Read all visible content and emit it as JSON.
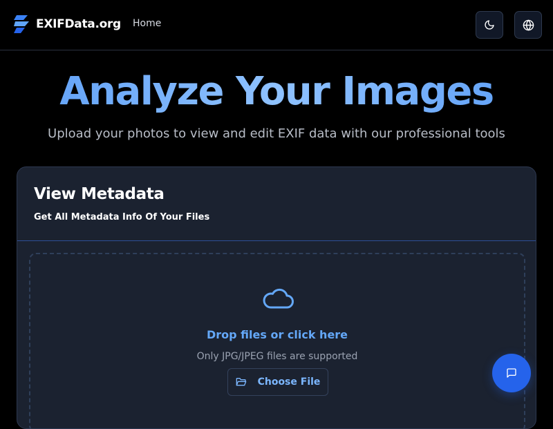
{
  "header": {
    "brand": "EXIFData.org",
    "nav": {
      "home": "Home"
    },
    "theme_toggle_icon": "moon-icon",
    "language_icon": "globe-icon"
  },
  "hero": {
    "title": "Analyze Your Images",
    "subtitle": "Upload your photos to view and edit EXIF data with our professional tools"
  },
  "card": {
    "title": "View Metadata",
    "subtitle": "Get All Metadata Info Of Your Files",
    "dropzone": {
      "icon": "cloud-icon",
      "title": "Drop files or click here",
      "note": "Only JPG/JPEG files are supported",
      "button_icon": "folder-open-icon",
      "button_label": "Choose File"
    }
  },
  "chat": {
    "icon": "chat-icon"
  },
  "colors": {
    "accent": "#3b82f6",
    "hero_title": "#6ea8fe",
    "card_bg": "#1b2230",
    "page_bg": "#000000"
  }
}
